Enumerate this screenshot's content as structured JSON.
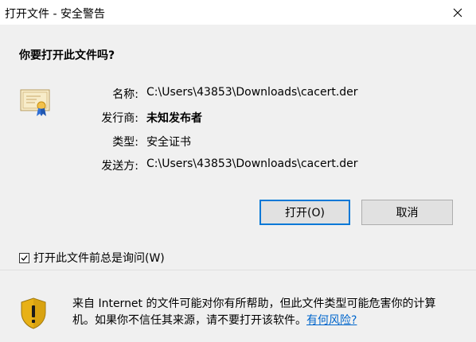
{
  "window": {
    "title": "打开文件 - 安全警告",
    "close_symbol": "✕"
  },
  "dialog": {
    "question": "你要打开此文件吗?",
    "fields": {
      "name_label": "名称:",
      "name_value": "C:\\Users\\43853\\Downloads\\cacert.der",
      "publisher_label": "发行商:",
      "publisher_value": "未知发布者",
      "type_label": "类型:",
      "type_value": "安全证书",
      "from_label": "发送方:",
      "from_value": "C:\\Users\\43853\\Downloads\\cacert.der"
    },
    "buttons": {
      "open_label": "打开(O)",
      "cancel_label": "取消"
    },
    "checkbox": {
      "label": "打开此文件前总是询问(W)",
      "checked": true
    }
  },
  "footer": {
    "warning_text": "来自 Internet 的文件可能对你有所帮助，但此文件类型可能危害你的计算机。如果你不信任其来源，请不要打开该软件。",
    "help_link": "有何风险?"
  },
  "colors": {
    "accent": "#0078d7",
    "link": "#0066cc",
    "dialog_bg": "#f0f0f0"
  },
  "icons": {
    "certificate": "certificate-icon",
    "shield": "security-shield-warning-icon",
    "close": "close-icon",
    "checkmark": "checkmark-icon"
  }
}
